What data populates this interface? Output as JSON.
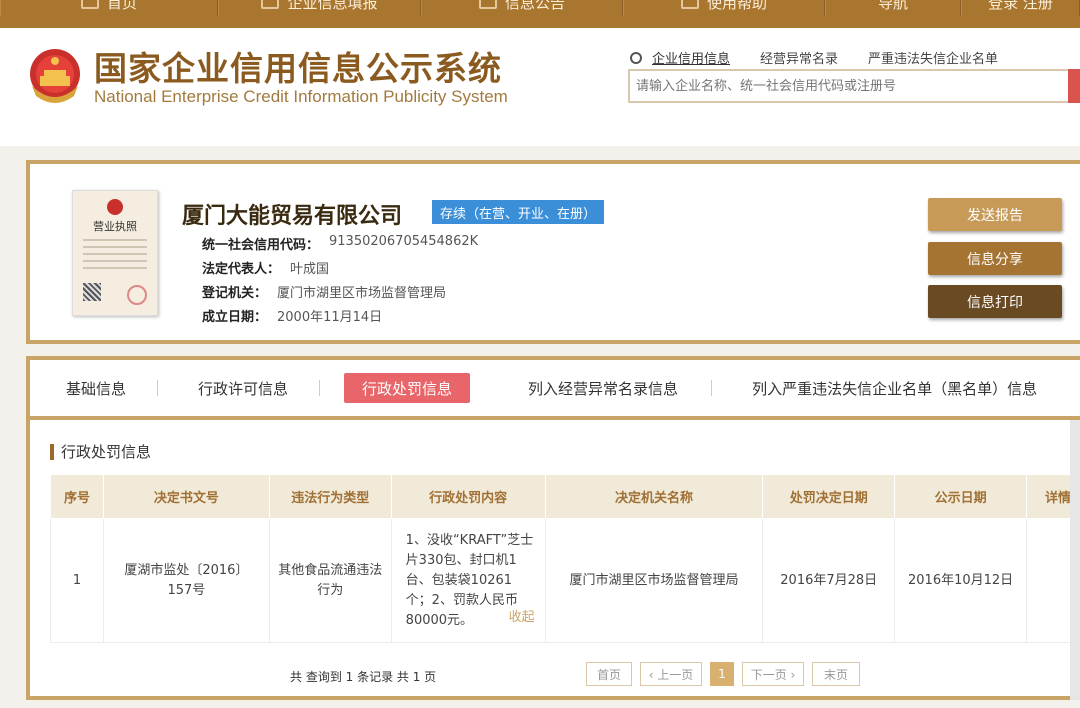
{
  "topnav": {
    "items": [
      "首页",
      "企业信息填报",
      "信息公告",
      "使用帮助",
      "导航",
      "登录 注册"
    ]
  },
  "header": {
    "title_cn": "国家企业信用信息公示系统",
    "title_en": "National Enterprise Credit Information Publicity System",
    "search_tabs": [
      "企业信用信息",
      "经营异常名录",
      "严重违法失信企业名单"
    ],
    "search_placeholder": "请输入企业名称、统一社会信用代码或注册号"
  },
  "company": {
    "license_title": "营业执照",
    "name": "厦门大能贸易有限公司",
    "status": "存续（在营、开业、在册）",
    "fields": [
      {
        "label": "统一社会信用代码：",
        "value": "91350206705454862K"
      },
      {
        "label": "法定代表人：",
        "value": "叶成国"
      },
      {
        "label": "登记机关：",
        "value": "厦门市湖里区市场监督管理局"
      },
      {
        "label": "成立日期：",
        "value": "2000年11月14日"
      }
    ],
    "buttons": {
      "send": "发送报告",
      "share": "信息分享",
      "print": "信息打印"
    }
  },
  "tabs": {
    "basic": "基础信息",
    "permit": "行政许可信息",
    "penalty": "行政处罚信息",
    "abnormal": "列入经营异常名录信息",
    "blacklist": "列入严重违法失信企业名单（黑名单）信息"
  },
  "section": {
    "title": "行政处罚信息"
  },
  "table": {
    "headers": [
      "序号",
      "决定书文号",
      "违法行为类型",
      "行政处罚内容",
      "决定机关名称",
      "处罚决定日期",
      "公示日期",
      "详情"
    ],
    "row": {
      "no": "1",
      "doc_no": "厦湖市监处〔2016〕157号",
      "type": "其他食品流通违法行为",
      "content": "1、没收“KRAFT”芝士片330包、封口机1台、包装袋10261个；2、罚款人民币80000元。",
      "collapse": "收起",
      "authority": "厦门市湖里区市场监督管理局",
      "decision_date": "2016年7月28日",
      "publish_date": "2016年10月12日",
      "detail": ""
    }
  },
  "pager": {
    "info": "共 查询到 1 条记录 共 1 页",
    "first": "首页",
    "prev": "‹ 上一页",
    "current": "1",
    "next": "下一页 ›",
    "last": "末页"
  },
  "colors": {
    "brand": "#a9762f",
    "border": "#c8a466",
    "active_tab": "#e8666a",
    "status": "#3b8fd8"
  }
}
